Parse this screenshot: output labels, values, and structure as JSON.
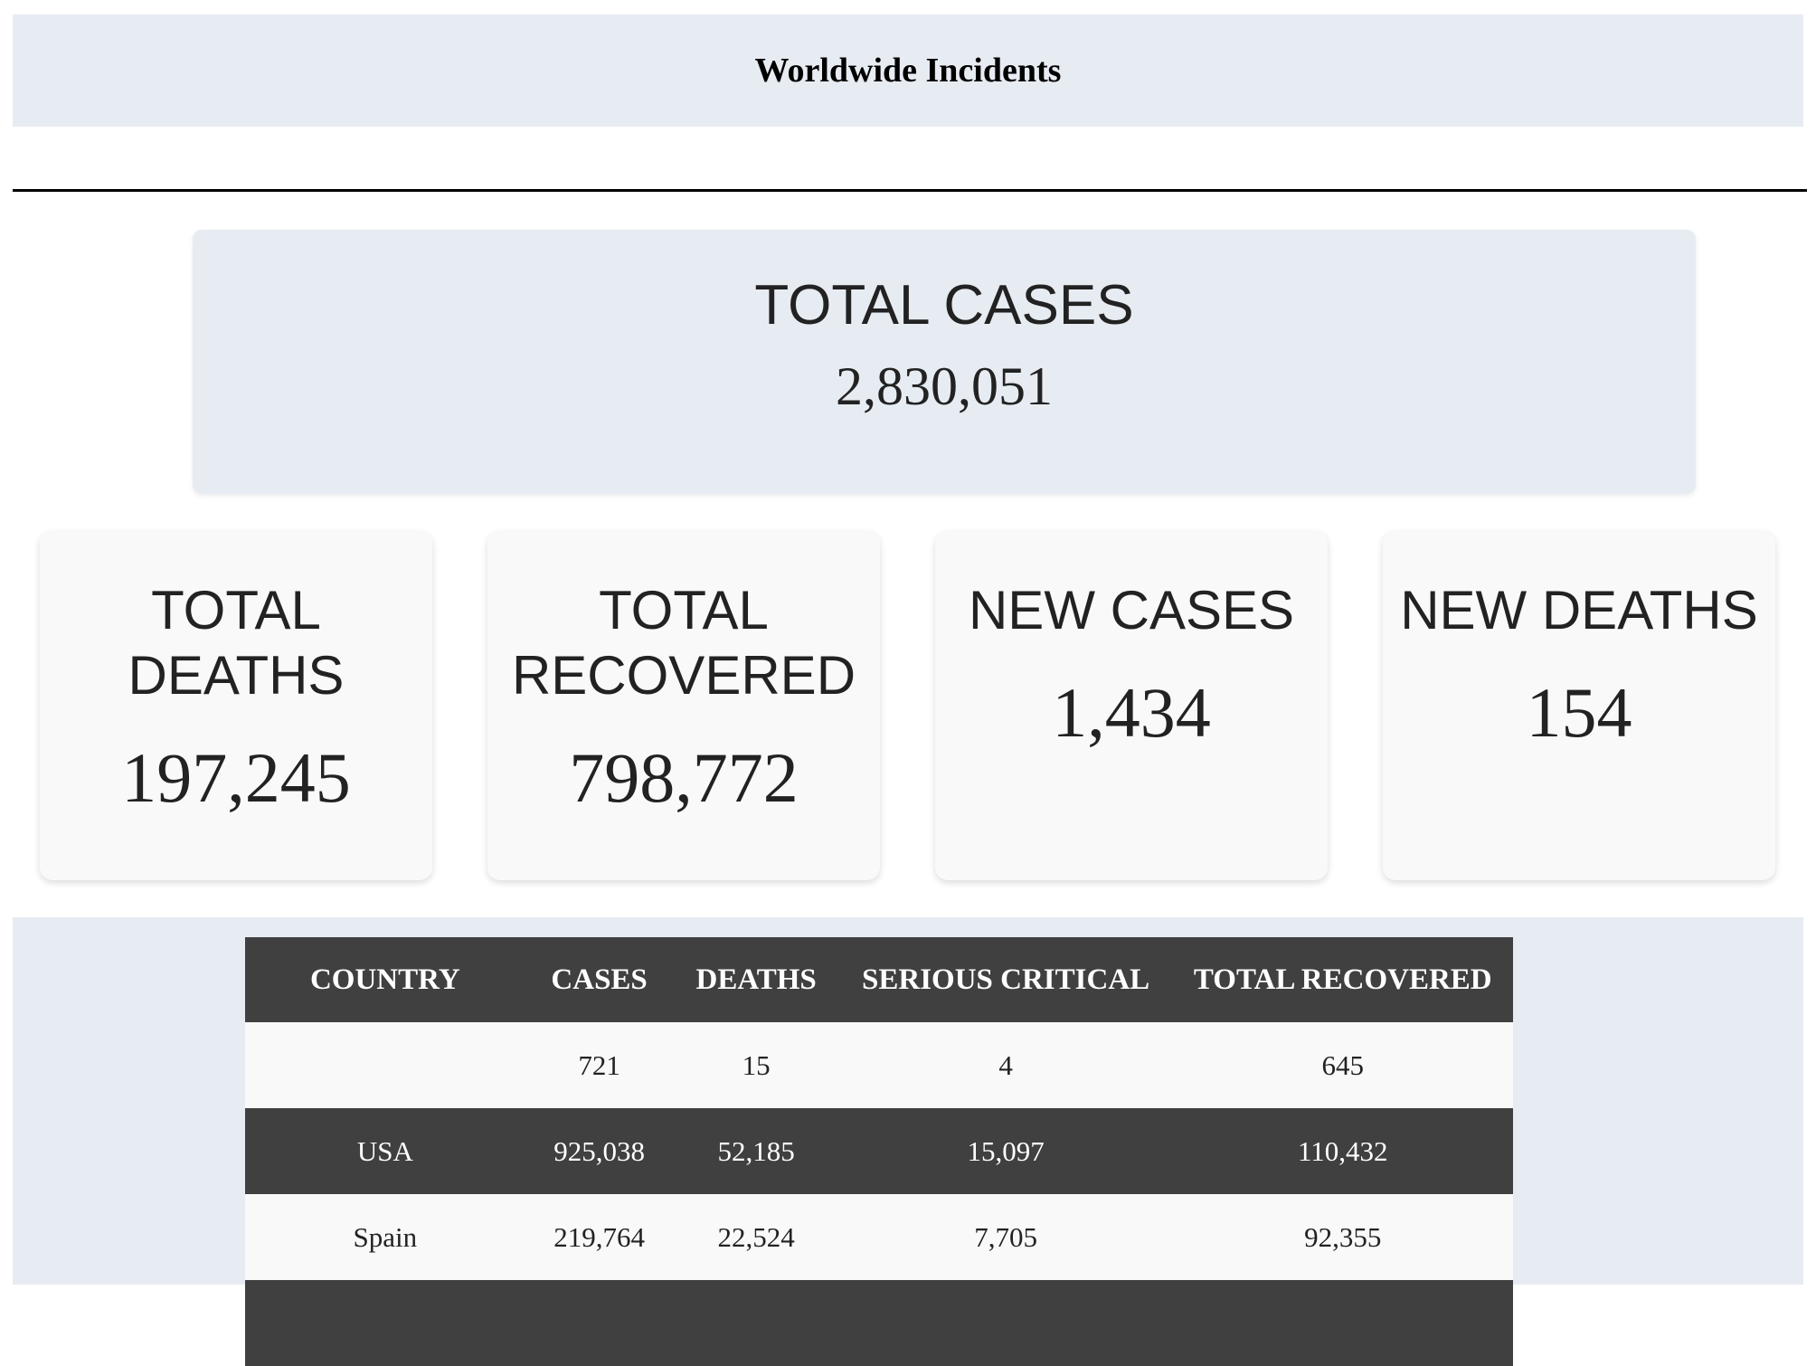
{
  "header": {
    "title": "Worldwide Incidents"
  },
  "total_cases": {
    "label": "TOTAL CASES",
    "value": "2,830,051"
  },
  "stats": {
    "total_deaths": {
      "label": "TOTAL DEATHS",
      "value": "197,245"
    },
    "total_recovered": {
      "label": "TOTAL RECOVERED",
      "value": "798,772"
    },
    "new_cases": {
      "label": "NEW CASES",
      "value": "1,434"
    },
    "new_deaths": {
      "label": "NEW DEATHS",
      "value": "154"
    }
  },
  "table": {
    "headers": {
      "country": "COUNTRY",
      "cases": "CASES",
      "deaths": "DEATHS",
      "serious_critical": "SERIOUS CRITICAL",
      "total_recovered": "TOTAL RECOVERED"
    },
    "rows": [
      {
        "country": "",
        "cases": "721",
        "deaths": "15",
        "serious_critical": "4",
        "total_recovered": "645"
      },
      {
        "country": "USA",
        "cases": "925,038",
        "deaths": "52,185",
        "serious_critical": "15,097",
        "total_recovered": "110,432"
      },
      {
        "country": "Spain",
        "cases": "219,764",
        "deaths": "22,524",
        "serious_critical": "7,705",
        "total_recovered": "92,355"
      }
    ]
  },
  "colors": {
    "panel_background": "#e7ebf2",
    "card_background": "#f9f9f9",
    "table_dark_row": "#404040",
    "text": "#222222"
  }
}
